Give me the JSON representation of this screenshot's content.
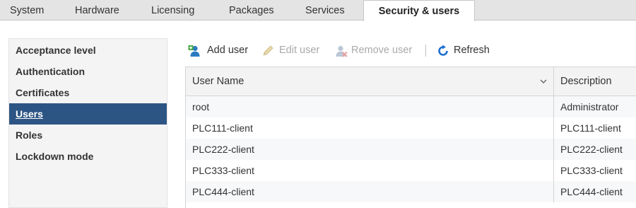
{
  "tabs": [
    {
      "label": "System"
    },
    {
      "label": "Hardware"
    },
    {
      "label": "Licensing"
    },
    {
      "label": "Packages"
    },
    {
      "label": "Services"
    },
    {
      "label": "Security & users",
      "active": true
    }
  ],
  "sidebar": {
    "items": [
      {
        "label": "Acceptance level"
      },
      {
        "label": "Authentication"
      },
      {
        "label": "Certificates"
      },
      {
        "label": "Users",
        "active": true
      },
      {
        "label": "Roles"
      },
      {
        "label": "Lockdown mode"
      }
    ]
  },
  "toolbar": {
    "add_user": {
      "label": "Add user",
      "icon": "add-user-icon",
      "enabled": true
    },
    "edit_user": {
      "label": "Edit user",
      "icon": "edit-pencil-icon",
      "enabled": false
    },
    "remove_user": {
      "label": "Remove user",
      "icon": "remove-user-icon",
      "enabled": false
    },
    "refresh": {
      "label": "Refresh",
      "icon": "refresh-icon",
      "enabled": true
    }
  },
  "grid": {
    "columns": [
      "User Name",
      "Description"
    ],
    "rows": [
      {
        "user_name": "root",
        "description": "Administrator"
      },
      {
        "user_name": "PLC111-client",
        "description": "PLC111-client"
      },
      {
        "user_name": "PLC222-client",
        "description": "PLC222-client"
      },
      {
        "user_name": "PLC333-client",
        "description": "PLC333-client"
      },
      {
        "user_name": "PLC444-client",
        "description": "PLC444-client"
      }
    ]
  },
  "colors": {
    "accent": "#2c5584",
    "refresh_icon": "#1f6fd1",
    "add_user_icon": "#2a7bbf",
    "disabled_text": "#a9a9a9"
  }
}
